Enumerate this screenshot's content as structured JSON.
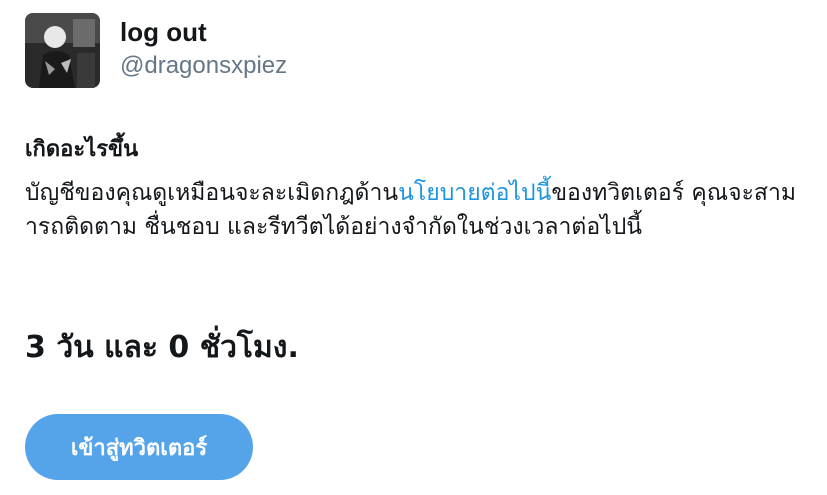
{
  "account": {
    "display_name": "log out",
    "handle": "@dragonsxpiez",
    "avatar_icon": "profile-photo"
  },
  "notice": {
    "heading": "เกิดอะไรขึ้น",
    "text_before_link": "บัญชีของคุณดูเหมือนจะละเมิดกฎด้าน",
    "link_text": "นโยบายต่อไปนี้",
    "text_after_link": "ของทวิตเตอร์ คุณจะสามารถติดตาม ชื่นชอบ และรีทวีตได้อย่างจำกัดในช่วงเวลาต่อไปนี้",
    "duration": "3 วัน และ 0 ชั่วโมง."
  },
  "actions": {
    "enter_twitter_label": "เข้าสู่ทวิตเตอร์"
  },
  "colors": {
    "link": "#1b95e0",
    "button": "#55a4ea",
    "handle": "#657786",
    "text": "#14171a"
  }
}
